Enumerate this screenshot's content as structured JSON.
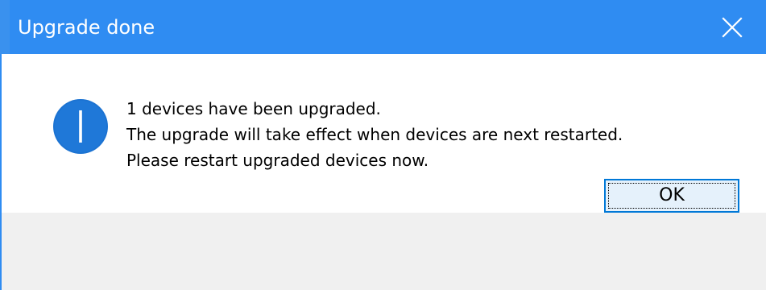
{
  "dialog": {
    "title": "Upgrade done",
    "close_icon": "close-icon",
    "info_icon": "info-icon",
    "message_lines": [
      "1 devices have been upgraded.",
      "The upgrade will take effect when devices are next restarted.",
      "Please restart upgraded devices now."
    ],
    "ok_label": "OK"
  },
  "colors": {
    "titlebar": "#2f8cf2",
    "info_icon": "#1c73d2",
    "footer_bg": "#f0f0f0",
    "button_border": "#0078d7",
    "button_bg": "#e5f1fb"
  }
}
